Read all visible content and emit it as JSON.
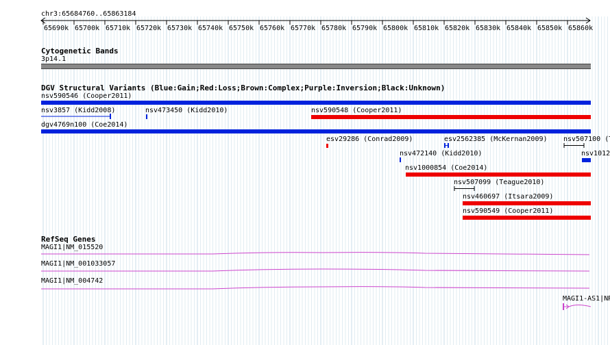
{
  "ruler": {
    "position": "chr3:65684760..65863184",
    "ticks": [
      "65690k",
      "65700k",
      "65710k",
      "65720k",
      "65730k",
      "65740k",
      "65750k",
      "65760k",
      "65770k",
      "65780k",
      "65790k",
      "65800k",
      "65810k",
      "65820k",
      "65830k",
      "65840k",
      "65850k",
      "65860k"
    ]
  },
  "cyto": {
    "title": "Cytogenetic Bands",
    "band": "3p14.1"
  },
  "dgv": {
    "title": "DGV Structural Variants (Blue:Gain;Red:Loss;Brown:Complex;Purple:Inversion;Black:Unknown)",
    "colors": {
      "gain": "#0022dd",
      "loss": "#ee0000",
      "unknown": "#000000"
    },
    "features": [
      {
        "label": "nsv590546 (Cooper2011)"
      },
      {
        "label": "nsv3857 (Kidd2008)"
      },
      {
        "label": "nsv473450 (Kidd2010)"
      },
      {
        "label": "nsv590548 (Cooper2011)"
      },
      {
        "label": "dgv4769n100 (Coe2014)"
      },
      {
        "label": "esv29286 (Conrad2009)"
      },
      {
        "label": "esv2562385 (McKernan2009)"
      },
      {
        "label": "nsv507100 (T"
      },
      {
        "label": "nsv472140 (Kidd2010)"
      },
      {
        "label": "nsv1012"
      },
      {
        "label": "nsv1000854 (Coe2014)"
      },
      {
        "label": "nsv507099 (Teague2010)"
      },
      {
        "label": "nsv460697 (Itsara2009)"
      },
      {
        "label": "nsv590549 (Cooper2011)"
      }
    ]
  },
  "refseq": {
    "title": "RefSeq Genes",
    "genes": [
      {
        "label": "MAGI1|NM_015520"
      },
      {
        "label": "MAGI1|NM_001033057"
      },
      {
        "label": "MAGI1|NM_004742"
      },
      {
        "label": "MAGI1-AS1|NR"
      }
    ],
    "color": "#cc44cc"
  }
}
